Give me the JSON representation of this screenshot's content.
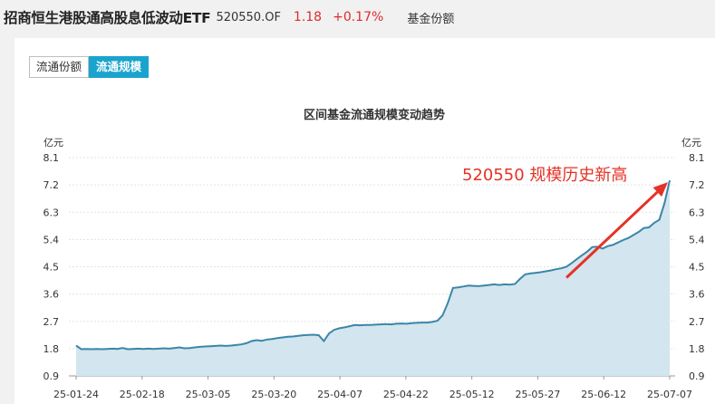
{
  "header": {
    "fund_name": "招商恒生港股通高股息低波动ETF",
    "fund_code": "520550.OF",
    "price": "1.18",
    "change": "+0.17%",
    "meta_label": "基金份额"
  },
  "tabs": [
    {
      "label": "流通份额",
      "active": false
    },
    {
      "label": "流通规模",
      "active": true
    }
  ],
  "colors": {
    "accent": "#1aa4cd",
    "line": "#3b86a8",
    "area": "#d3e5ee",
    "up": "#e02b2b",
    "annotation": "#e53226"
  },
  "chart_data": {
    "type": "area",
    "title": "区间基金流通规模变动趋势",
    "y_unit_left": "亿元",
    "y_unit_right": "亿元",
    "ylim": [
      0.9,
      8.1
    ],
    "y_ticks": [
      0.9,
      1.8,
      2.7,
      3.6,
      4.5,
      5.4,
      6.3,
      7.2,
      8.1
    ],
    "x_labels": [
      "25-01-24",
      "25-02-18",
      "25-03-05",
      "25-03-20",
      "25-04-07",
      "25-04-22",
      "25-05-12",
      "25-05-27",
      "25-06-12",
      "25-07-07"
    ],
    "grid": true,
    "annotation": "520550 规模历史新高",
    "series": [
      {
        "values": [
          1.9,
          1.78,
          1.79,
          1.78,
          1.79,
          1.78,
          1.79,
          1.8,
          1.79,
          1.82,
          1.78,
          1.79,
          1.8,
          1.79,
          1.8,
          1.79,
          1.8,
          1.81,
          1.8,
          1.82,
          1.84,
          1.81,
          1.82,
          1.84,
          1.86,
          1.87,
          1.88,
          1.89,
          1.9,
          1.89,
          1.9,
          1.92,
          1.94,
          1.98,
          2.05,
          2.08,
          2.06,
          2.1,
          2.12,
          2.15,
          2.17,
          2.19,
          2.2,
          2.22,
          2.24,
          2.25,
          2.26,
          2.24,
          2.05,
          2.3,
          2.42,
          2.47,
          2.5,
          2.54,
          2.58,
          2.57,
          2.58,
          2.58,
          2.59,
          2.6,
          2.61,
          2.6,
          2.62,
          2.63,
          2.62,
          2.64,
          2.65,
          2.66,
          2.66,
          2.68,
          2.72,
          2.9,
          3.3,
          3.8,
          3.82,
          3.85,
          3.88,
          3.87,
          3.86,
          3.88,
          3.9,
          3.92,
          3.9,
          3.92,
          3.91,
          3.93,
          4.1,
          4.25,
          4.28,
          4.3,
          4.32,
          4.35,
          4.38,
          4.42,
          4.45,
          4.5,
          4.62,
          4.75,
          4.88,
          5.0,
          5.15,
          5.16,
          5.1,
          5.18,
          5.22,
          5.3,
          5.38,
          5.45,
          5.55,
          5.65,
          5.78,
          5.8,
          5.95,
          6.05,
          6.6,
          7.35
        ]
      }
    ]
  }
}
